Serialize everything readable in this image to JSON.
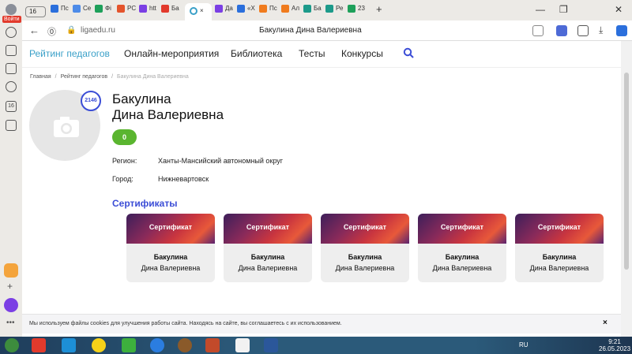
{
  "browser": {
    "tab_count": "16",
    "tabs": [
      {
        "label": "Пс",
        "color": "#2b6fdc"
      },
      {
        "label": "Се",
        "color": "#4d8be8"
      },
      {
        "label": "Фі",
        "color": "#1ea05a"
      },
      {
        "label": "PC",
        "color": "#e4542c"
      },
      {
        "label": "htt",
        "color": "#7b3fe4"
      },
      {
        "label": "Ба",
        "color": "#e23a2c"
      },
      {
        "label": "Да",
        "color": "#7b3fe4"
      },
      {
        "label": "«Х",
        "color": "#2b6fdc"
      },
      {
        "label": "Пс",
        "color": "#f07b1d"
      },
      {
        "label": "Ал",
        "color": "#f07b1d"
      },
      {
        "label": "Ба",
        "color": "#1c9a8a"
      },
      {
        "label": "Ре",
        "color": "#1c9a8a"
      },
      {
        "label": "23",
        "color": "#1ea05a"
      }
    ],
    "active_tab_close": "×",
    "new_tab": "+",
    "address": {
      "back": "←",
      "url": "ligaedu.ru",
      "page_title": "Бакулина Дина Валериевна"
    },
    "sidebar_login": "Войти",
    "sidebar_badge": "16"
  },
  "site": {
    "nav": [
      {
        "label": "Рейтинг педагогов",
        "active": true
      },
      {
        "label": "Онлайн-мероприятия"
      },
      {
        "label": "Библиотека"
      },
      {
        "label": "Тесты"
      },
      {
        "label": "Конкурсы"
      }
    ],
    "breadcrumbs": [
      "Главная",
      "Рейтинг педагогов",
      "Бакулина Дина Валериевна"
    ],
    "profile": {
      "rating": "2146",
      "surname": "Бакулина",
      "given": "Дина Валериевна",
      "score": "0",
      "region_label": "Регион:",
      "region_value": "Ханты-Мансийский автономный округ",
      "city_label": "Город:",
      "city_value": "Нижневартовск"
    },
    "certificates_heading": "Сертификаты",
    "certificates": [
      {
        "title": "Сертификат",
        "line1": "Бакулина",
        "line2": "Дина Валериевна"
      },
      {
        "title": "Сертификат",
        "line1": "Бакулина",
        "line2": "Дина Валериевна"
      },
      {
        "title": "Сертификат",
        "line1": "Бакулина",
        "line2": "Дина Валериевна"
      },
      {
        "title": "Сертификат",
        "line1": "Бакулина",
        "line2": "Дина Валериевна"
      },
      {
        "title": "Сертификат",
        "line1": "Бакулина",
        "line2": "Дина Валериевна"
      }
    ],
    "cookie_text": "Мы используем файлы cookies для улучшения работы сайта. Находясь на сайте, вы соглашаетесь с их использованием.",
    "cookie_close": "×"
  },
  "taskbar": {
    "lang": "RU",
    "time": "9:21",
    "date": "26.05.2023"
  },
  "colors": {
    "accent": "#3b4dd6",
    "nav_active": "#3aa0c8",
    "score_green": "#5ab52f"
  }
}
